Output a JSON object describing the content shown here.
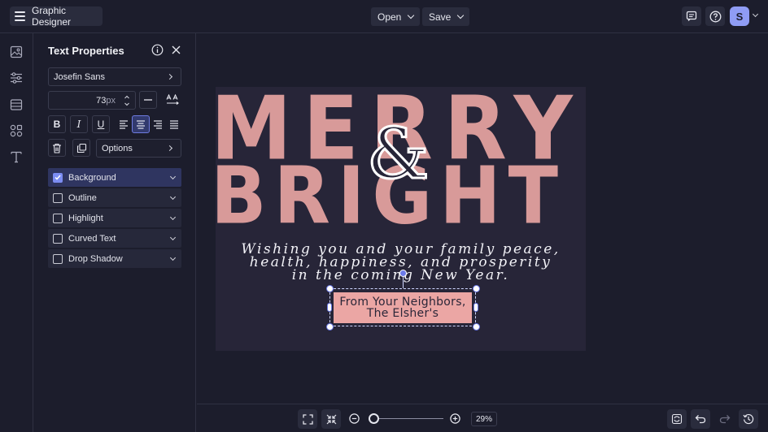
{
  "app": {
    "title": "Graphic Designer"
  },
  "toolbar": {
    "open_label": "Open",
    "save_label": "Save",
    "user_initial": "S"
  },
  "rail": {
    "icons": [
      "image-icon",
      "sliders-icon",
      "layout-icon",
      "elements-icon",
      "text-icon"
    ]
  },
  "panel": {
    "title": "Text Properties",
    "font_family": "Josefin Sans",
    "font_size": "73",
    "font_size_unit": "px",
    "options_label": "Options",
    "properties": [
      {
        "label": "Background",
        "checked": true
      },
      {
        "label": "Outline",
        "checked": false
      },
      {
        "label": "Highlight",
        "checked": false
      },
      {
        "label": "Curved Text",
        "checked": false
      },
      {
        "label": "Drop Shadow",
        "checked": false
      }
    ],
    "active_alignment": "center"
  },
  "canvas": {
    "word1": "MERRY",
    "ampersand": "&",
    "word2": "BRIGHT",
    "wish_lines": [
      "Wishing you and your family peace,",
      "health, happiness, and prosperity",
      "in the coming New Year."
    ],
    "sign_lines": [
      "From Your Neighbors,",
      "The Elsher's"
    ],
    "colors": {
      "artboard": "#272538",
      "title": "#d89a99",
      "sign_bg": "#eba6a4",
      "accent": "#7c8df2"
    }
  },
  "zoom": {
    "value": "29",
    "unit": "%"
  }
}
